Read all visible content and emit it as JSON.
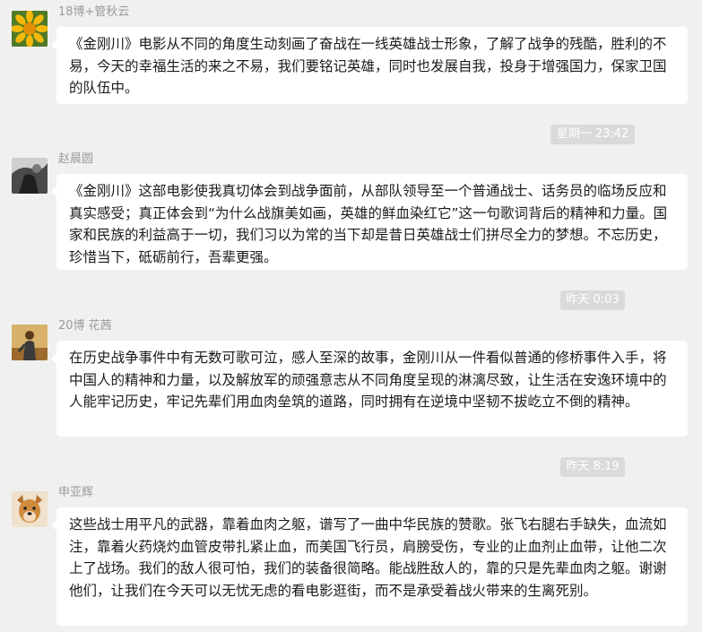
{
  "messages": [
    {
      "sender": "18博+管秋云",
      "avatar_icon": "sunflower-avatar",
      "text": "《金刚川》电影从不同的角度生动刻画了奋战在一线英雄战士形象，了解了战争的残酷，胜利的不易，今天的幸福生活的来之不易，我们要铭记英雄，同时也发展自我，投身于增强国力，保家卫国的队伍中。"
    },
    {
      "sender": "赵晨圆",
      "avatar_icon": "grayscale-photo-avatar",
      "text": "《金刚川》这部电影使我真切体会到战争面前，从部队领导至一个普通战士、话务员的临场反应和真实感受；真正体会到“为什么战旗美如画，英雄的鲜血染红它”这一句歌词背后的精神和力量。国家和民族的利益高于一切，我们习以为常的当下却是昔日英雄战士们拼尽全力的梦想。不忘历史，珍惜当下，砥砺前行，吾辈更强。"
    },
    {
      "sender": "20博 花茜",
      "avatar_icon": "painted-figure-avatar",
      "text": "在历史战争事件中有无数可歌可泣，感人至深的故事，金刚川从一件看似普通的修桥事件入手，将中国人的精神和力量，以及解放军的顽强意志从不同角度呈现的淋漓尽致，让生活在安逸环境中的人能牢记历史，牢记先辈们用血肉垒筑的道路，同时拥有在逆境中坚韧不拔屹立不倒的精神。"
    },
    {
      "sender": "申亚辉",
      "avatar_icon": "dog-avatar",
      "text": "这些战士用平凡的武器，靠着血肉之躯，谱写了一曲中华民族的赞歌。张飞右腿右手缺失，血流如注，靠着火药烧灼血管皮带扎紧止血，而美国飞行员，肩膀受伤，专业的止血剂止血带，让他二次上了战场。我们的敌人很可怕，我们的装备很简略。能战胜敌人的，靠的只是先辈血肉之躯。谢谢他们，让我们在今天可以无忧无虑的看电影逛街，而不是承受着战火带来的生离死别。"
    }
  ],
  "timestamps": [
    "星期一 23:42",
    "昨天 0:03",
    "昨天 8:19"
  ],
  "colors": {
    "background": "#f0f0f0",
    "bubble": "#ffffff",
    "timestamp_pill": "#dadada",
    "sender_name": "#9a9a9a"
  }
}
